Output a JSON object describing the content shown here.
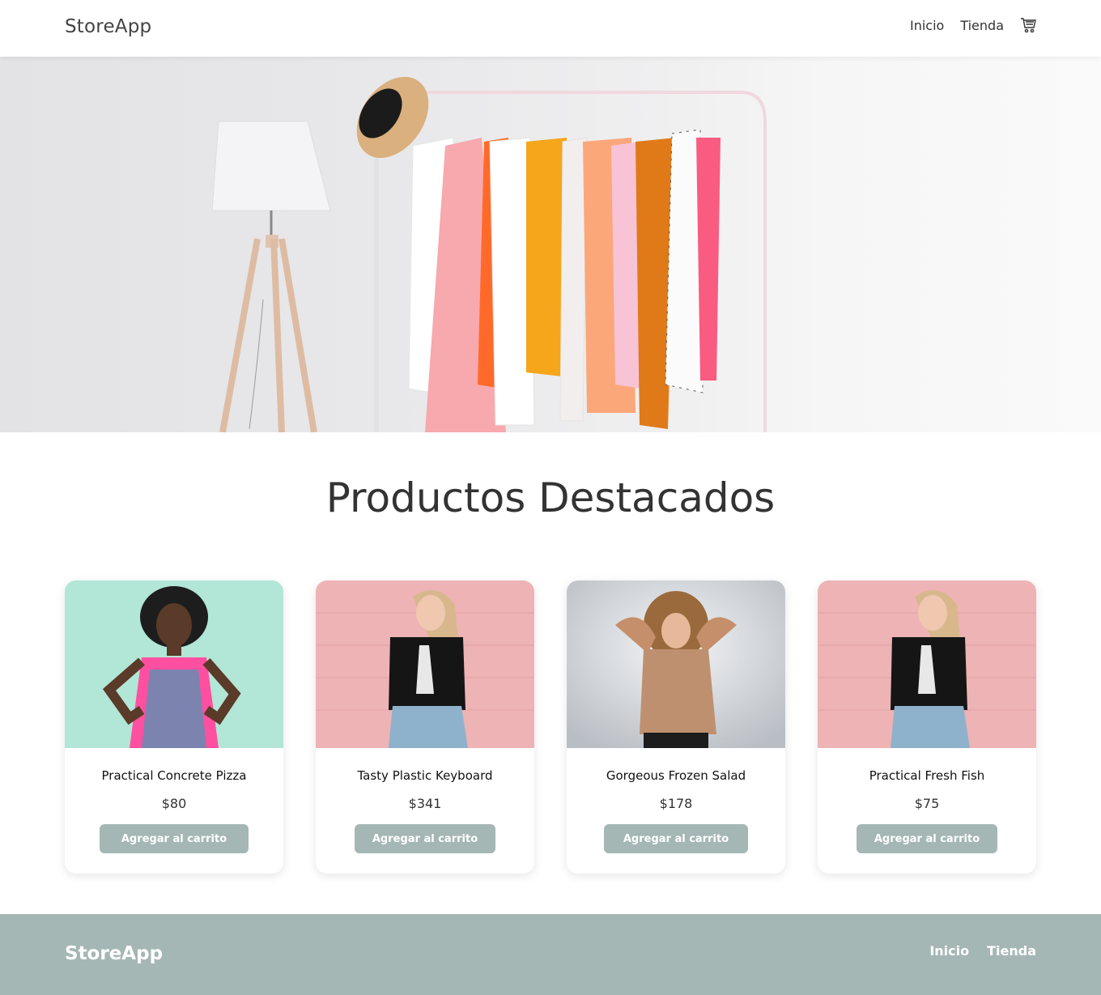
{
  "header": {
    "brand": "StoreApp",
    "nav": {
      "home": "Inicio",
      "shop": "Tienda"
    },
    "cart_icon": "cart-icon"
  },
  "hero": {
    "image": "clothing-rack-hero"
  },
  "featured": {
    "title": "Productos Destacados",
    "products": [
      {
        "name": "Practical Concrete Pizza",
        "price": "$80",
        "button": "Agregar al carrito"
      },
      {
        "name": "Tasty Plastic Keyboard",
        "price": "$341",
        "button": "Agregar al carrito"
      },
      {
        "name": "Gorgeous Frozen Salad",
        "price": "$178",
        "button": "Agregar al carrito"
      },
      {
        "name": "Practical Fresh Fish",
        "price": "$75",
        "button": "Agregar al carrito"
      }
    ]
  },
  "footer": {
    "brand": "StoreApp",
    "nav": {
      "home": "Inicio",
      "shop": "Tienda"
    }
  },
  "colors": {
    "accent": "#a5b7b5",
    "text": "#333333"
  }
}
